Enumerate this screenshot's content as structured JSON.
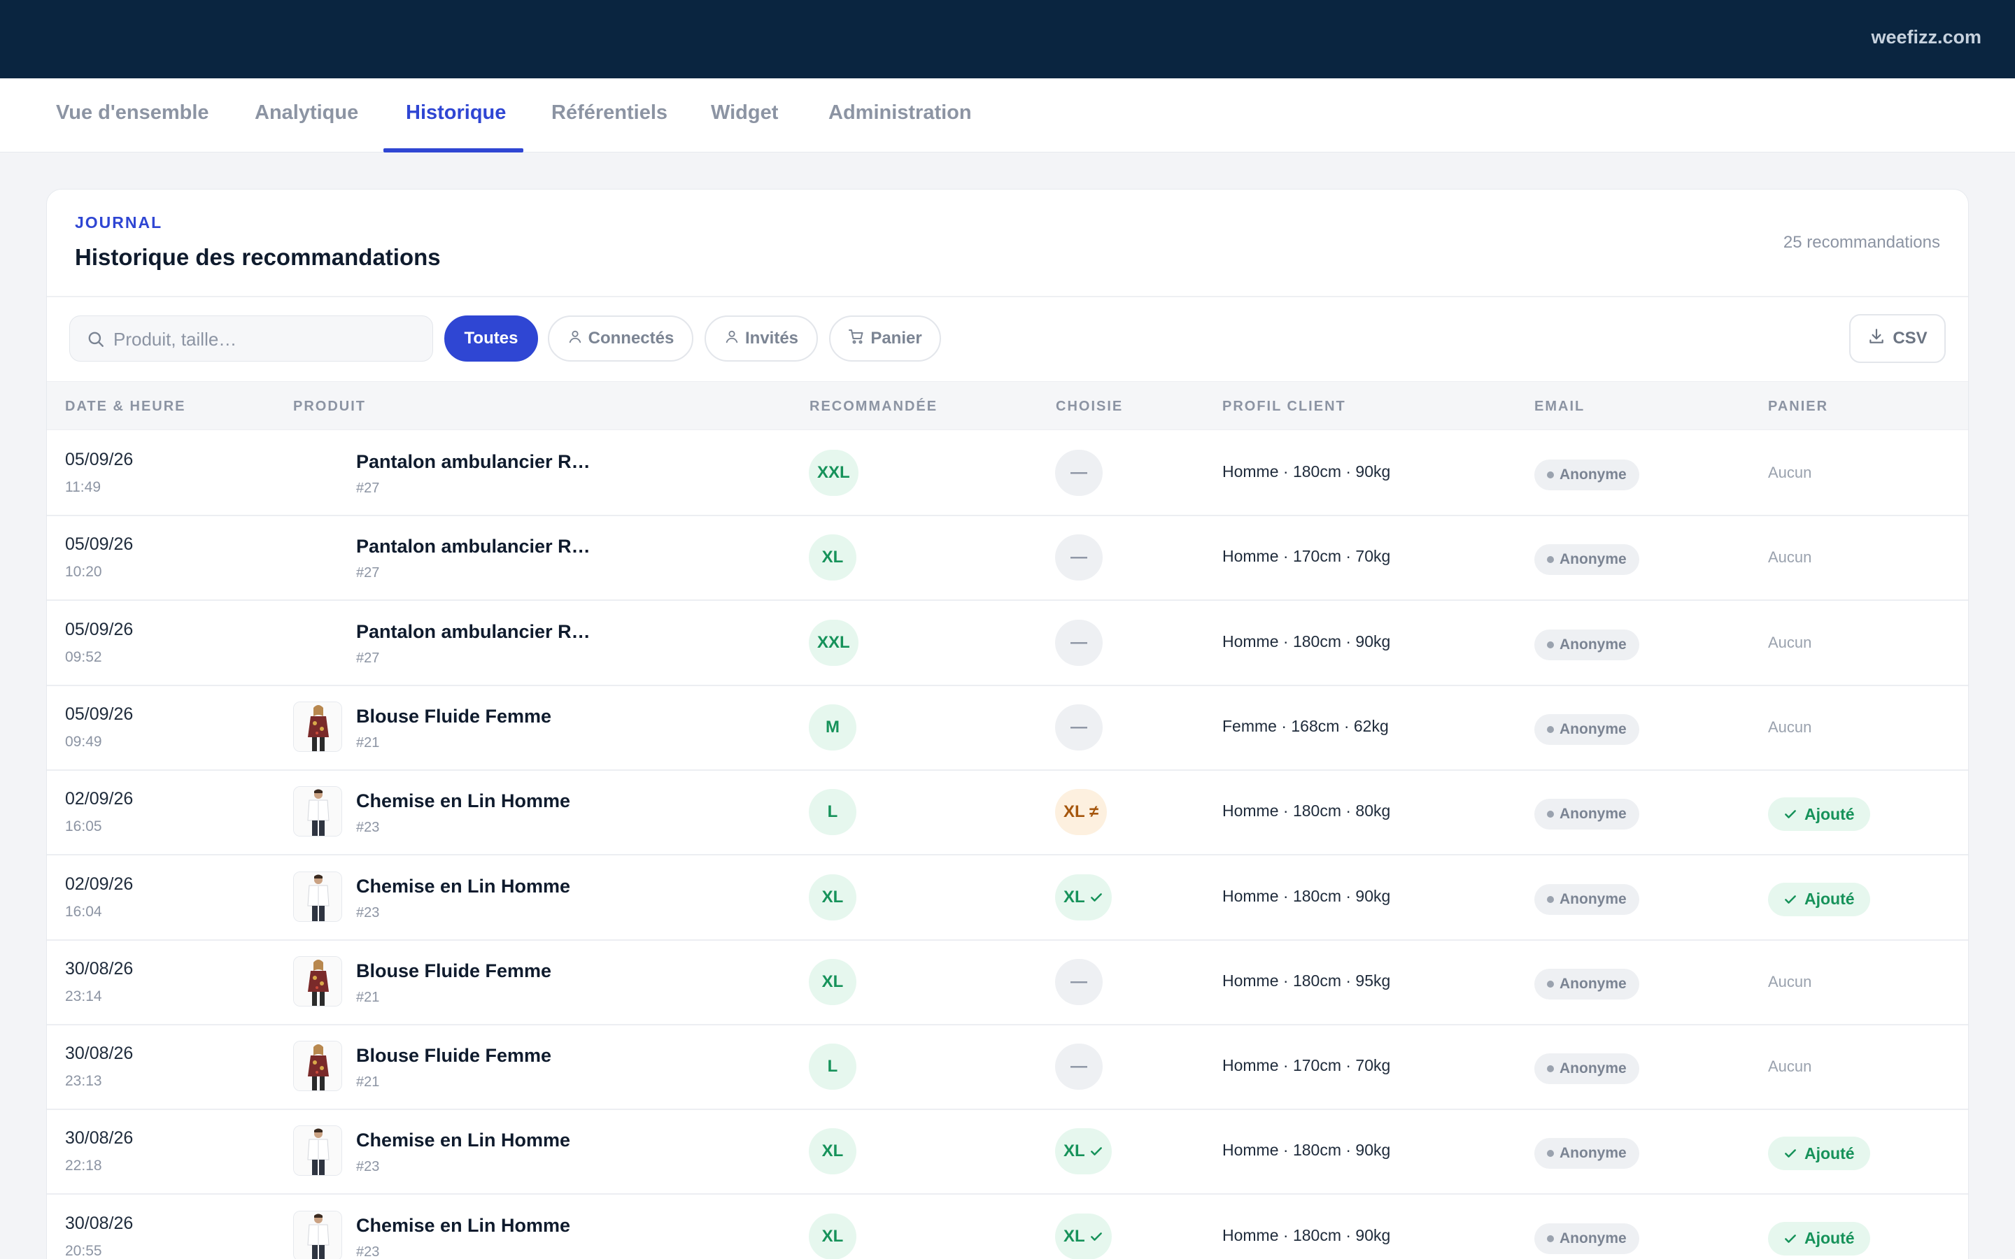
{
  "header": {
    "domain": "weefizz.com"
  },
  "tabs": [
    {
      "label": "Vue d'ensemble"
    },
    {
      "label": "Analytique"
    },
    {
      "label": "Historique",
      "active": true
    },
    {
      "label": "Référentiels"
    },
    {
      "label": "Widget"
    },
    {
      "label": "Administration"
    }
  ],
  "card": {
    "kicker": "JOURNAL",
    "title": "Historique des recommandations",
    "count": "25 recommandations"
  },
  "filters": {
    "search_placeholder": "Produit, taille…",
    "all": "Toutes",
    "connected": "Connectés",
    "guests": "Invités",
    "cart": "Panier",
    "csv": "CSV"
  },
  "columns": {
    "date": "DATE & HEURE",
    "product": "PRODUIT",
    "recommended": "RECOMMANDÉE",
    "chosen": "CHOISIE",
    "profile": "PROFIL CLIENT",
    "email": "EMAIL",
    "cart": "PANIER"
  },
  "rows": [
    {
      "date": "05/09/26",
      "time": "11:49",
      "product": "Pantalon ambulancier R…",
      "id": "#27",
      "thumb": "none",
      "rec": "XXL",
      "chosen": "—",
      "chosen_state": "none",
      "profile": "Homme · 180cm · 90kg",
      "email": "Anonyme",
      "cart": "Aucun",
      "cart_state": "none"
    },
    {
      "date": "05/09/26",
      "time": "10:20",
      "product": "Pantalon ambulancier R…",
      "id": "#27",
      "thumb": "none",
      "rec": "XL",
      "chosen": "—",
      "chosen_state": "none",
      "profile": "Homme · 170cm · 70kg",
      "email": "Anonyme",
      "cart": "Aucun",
      "cart_state": "none"
    },
    {
      "date": "05/09/26",
      "time": "09:52",
      "product": "Pantalon ambulancier R…",
      "id": "#27",
      "thumb": "none",
      "rec": "XXL",
      "chosen": "—",
      "chosen_state": "none",
      "profile": "Homme · 180cm · 90kg",
      "email": "Anonyme",
      "cart": "Aucun",
      "cart_state": "none"
    },
    {
      "date": "05/09/26",
      "time": "09:49",
      "product": "Blouse Fluide Femme",
      "id": "#21",
      "thumb": "blouse",
      "rec": "M",
      "chosen": "—",
      "chosen_state": "none",
      "profile": "Femme · 168cm · 62kg",
      "email": "Anonyme",
      "cart": "Aucun",
      "cart_state": "none"
    },
    {
      "date": "02/09/26",
      "time": "16:05",
      "product": "Chemise en Lin Homme",
      "id": "#23",
      "thumb": "shirt",
      "rec": "L",
      "chosen": "XL ≠",
      "chosen_state": "mismatch",
      "profile": "Homme · 180cm · 80kg",
      "email": "Anonyme",
      "cart": "Ajouté",
      "cart_state": "added"
    },
    {
      "date": "02/09/26",
      "time": "16:04",
      "product": "Chemise en Lin Homme",
      "id": "#23",
      "thumb": "shirt",
      "rec": "XL",
      "chosen": "XL",
      "chosen_state": "match",
      "profile": "Homme · 180cm · 90kg",
      "email": "Anonyme",
      "cart": "Ajouté",
      "cart_state": "added"
    },
    {
      "date": "30/08/26",
      "time": "23:14",
      "product": "Blouse Fluide Femme",
      "id": "#21",
      "thumb": "blouse",
      "rec": "XL",
      "chosen": "—",
      "chosen_state": "none",
      "profile": "Homme · 180cm · 95kg",
      "email": "Anonyme",
      "cart": "Aucun",
      "cart_state": "none"
    },
    {
      "date": "30/08/26",
      "time": "23:13",
      "product": "Blouse Fluide Femme",
      "id": "#21",
      "thumb": "blouse",
      "rec": "L",
      "chosen": "—",
      "chosen_state": "none",
      "profile": "Homme · 170cm · 70kg",
      "email": "Anonyme",
      "cart": "Aucun",
      "cart_state": "none"
    },
    {
      "date": "30/08/26",
      "time": "22:18",
      "product": "Chemise en Lin Homme",
      "id": "#23",
      "thumb": "shirt",
      "rec": "XL",
      "chosen": "XL",
      "chosen_state": "match",
      "profile": "Homme · 180cm · 90kg",
      "email": "Anonyme",
      "cart": "Ajouté",
      "cart_state": "added"
    },
    {
      "date": "30/08/26",
      "time": "20:55",
      "product": "Chemise en Lin Homme",
      "id": "#23",
      "thumb": "shirt",
      "rec": "XL",
      "chosen": "XL",
      "chosen_state": "match",
      "profile": "Homme · 180cm · 90kg",
      "email": "Anonyme",
      "cart": "Ajouté",
      "cart_state": "added"
    }
  ],
  "colors": {
    "topbar": "#0a2540",
    "accent": "#2f46d3",
    "success": "#16925a",
    "warning": "#a5560d"
  },
  "icons": {
    "search": "search-icon",
    "user": "user-icon",
    "cart": "cart-icon",
    "download": "download-icon",
    "check": "check-icon"
  }
}
